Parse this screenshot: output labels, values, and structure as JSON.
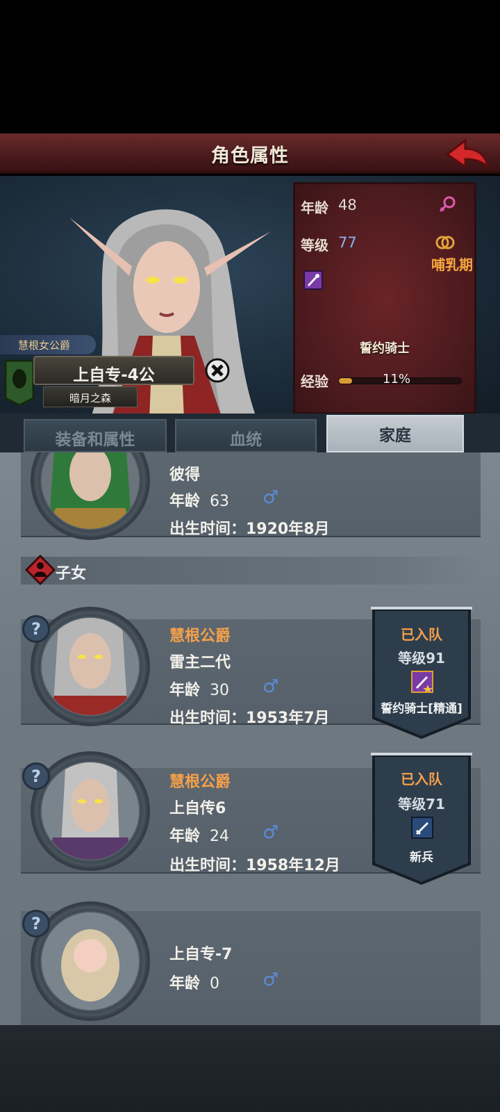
{
  "header": {
    "title": "角色属性"
  },
  "hero": {
    "title_tag": "慧根女公爵",
    "name": "上自专-4公",
    "region": "暗月之森"
  },
  "stats": {
    "age_label": "年龄",
    "age_value": "48",
    "level_label": "等级",
    "level_value": "77",
    "status": "哺乳期",
    "class_name": "誓约骑士",
    "exp_label": "经验",
    "exp_percent": "11%",
    "exp_fraction": 0.11
  },
  "tabs": [
    {
      "label": "装备和属性"
    },
    {
      "label": "血统"
    },
    {
      "label": "家庭"
    }
  ],
  "spouse": {
    "name": "彼得",
    "age_label": "年龄",
    "age": "63",
    "birth": "出生时间：1920年8月"
  },
  "children_section": {
    "label": "子女"
  },
  "children": [
    {
      "title": "慧根公爵",
      "name": "雷主二代",
      "age_label": "年龄",
      "age": "30",
      "birth": "出生时间：1953年7月",
      "team_status": "已入队",
      "level": "等级91",
      "class": "誓约骑士[精通]"
    },
    {
      "title": "慧根公爵",
      "name": "上自传6",
      "age_label": "年龄",
      "age": "24",
      "birth": "出生时间：1958年12月",
      "team_status": "已入队",
      "level": "等级71",
      "class": "新兵"
    },
    {
      "name": "上自专-7",
      "age_label": "年龄",
      "age": "0"
    }
  ],
  "colors": {
    "accent_orange": "#f4a04a",
    "male_blue": "#5c8cd8",
    "title_red": "#4a1a1c"
  }
}
